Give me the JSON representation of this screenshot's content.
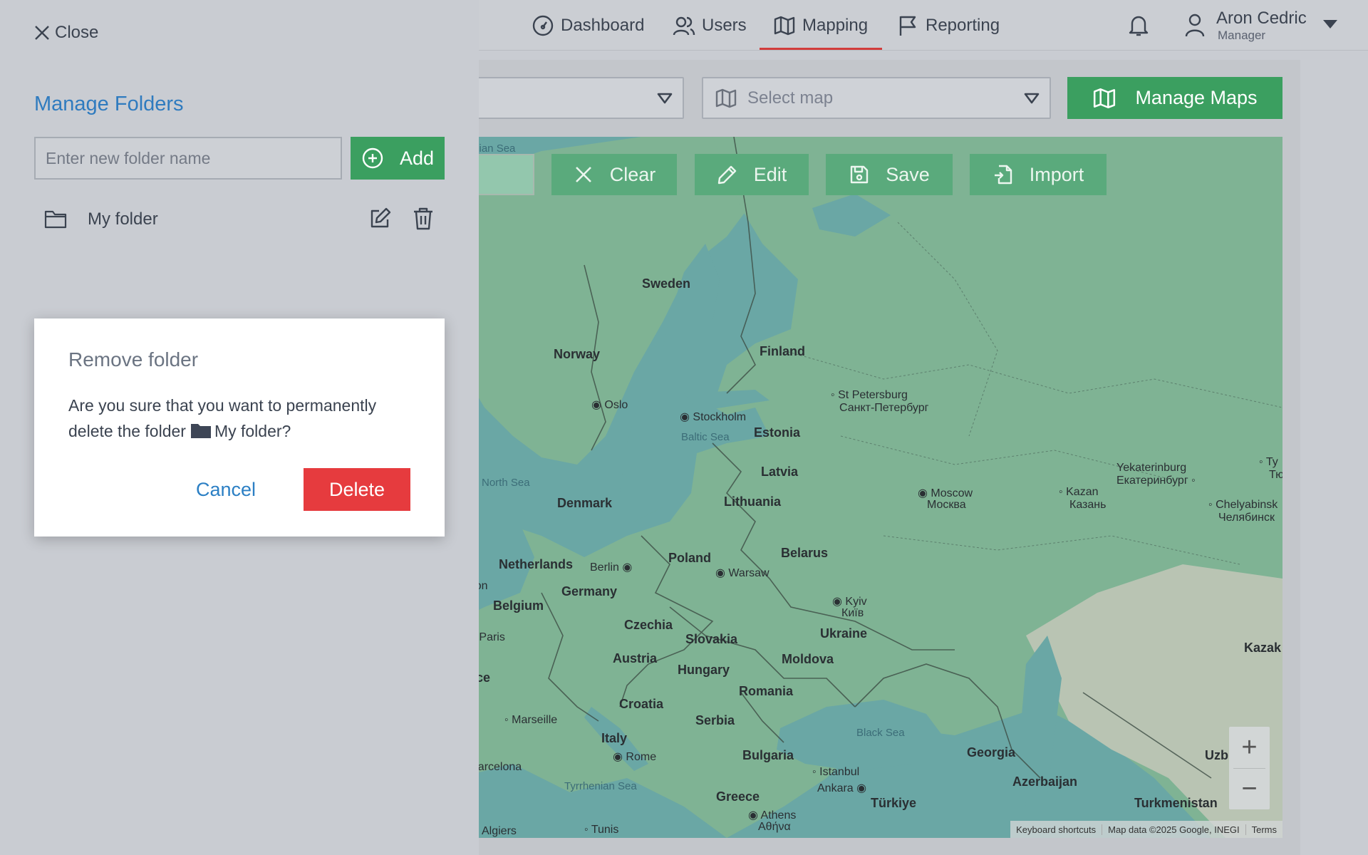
{
  "nav": {
    "items": [
      {
        "label": "Dashboard",
        "icon": "gauge-icon"
      },
      {
        "label": "Users",
        "icon": "users-icon"
      },
      {
        "label": "Mapping",
        "icon": "map-icon",
        "active": true
      },
      {
        "label": "Reporting",
        "icon": "flag-icon"
      }
    ],
    "user": {
      "name": "Aron Cedric",
      "role": "Manager"
    }
  },
  "toolbar": {
    "select_map_placeholder": "Select map",
    "manage_maps_label": "Manage Maps"
  },
  "map": {
    "buttons": {
      "clear": "Clear",
      "edit": "Edit",
      "save": "Save",
      "import": "Import"
    },
    "countries": [
      "Sweden",
      "Norway",
      "Finland",
      "Estonia",
      "Latvia",
      "Lithuania",
      "Denmark",
      "Netherlands",
      "Belgium",
      "Germany",
      "Poland",
      "Belarus",
      "Czechia",
      "Slovakia",
      "Austria",
      "Hungary",
      "Ukraine",
      "Moldova",
      "Romania",
      "Croatia",
      "Serbia",
      "Bulgaria",
      "Italy",
      "Greece",
      "Türkiye",
      "Georgia",
      "Azerbaijan",
      "Turkmenistan",
      "rance",
      "Kazak",
      "Uzb"
    ],
    "cities": [
      "Oslo",
      "Stockholm",
      "St Petersburg",
      "Санкт-Петербург",
      "Moscow",
      "Москва",
      "Kazan",
      "Казань",
      "Yekaterinburg",
      "Екатеринбург",
      "Chelyabinsk",
      "Челябинск",
      "Berlin",
      "Warsaw",
      "Kyiv",
      "Київ",
      "Paris",
      "Marseille",
      "Barcelona",
      "Rome",
      "Istanbul",
      "Ankara",
      "Athens",
      "Αθήνα",
      "Algiers",
      "Tunis",
      "ondon",
      "Ty",
      "Тю"
    ],
    "seas": [
      "rwegian Sea",
      "Baltic Sea",
      "North Sea",
      "Black Sea",
      "Tyrrhenian Sea"
    ],
    "zoom_in": "+",
    "zoom_out": "−",
    "attribution": {
      "shortcuts": "Keyboard shortcuts",
      "data": "Map data ©2025 Google, INEGI",
      "terms": "Terms"
    }
  },
  "side_panel": {
    "close_label": "Close",
    "title": "Manage Folders",
    "new_folder_placeholder": "Enter new folder name",
    "add_label": "Add",
    "folders": [
      {
        "name": "My folder"
      }
    ]
  },
  "dialog": {
    "title": "Remove folder",
    "text_before": "Are you sure that you want to permanently delete the folder",
    "folder_name": "My folder",
    "text_after": "?",
    "cancel_label": "Cancel",
    "delete_label": "Delete"
  },
  "colors": {
    "accent_green": "#3b9f60",
    "title_blue": "#2f7bbf",
    "danger_red": "#e63b3e",
    "active_underline": "#d23c3c"
  }
}
